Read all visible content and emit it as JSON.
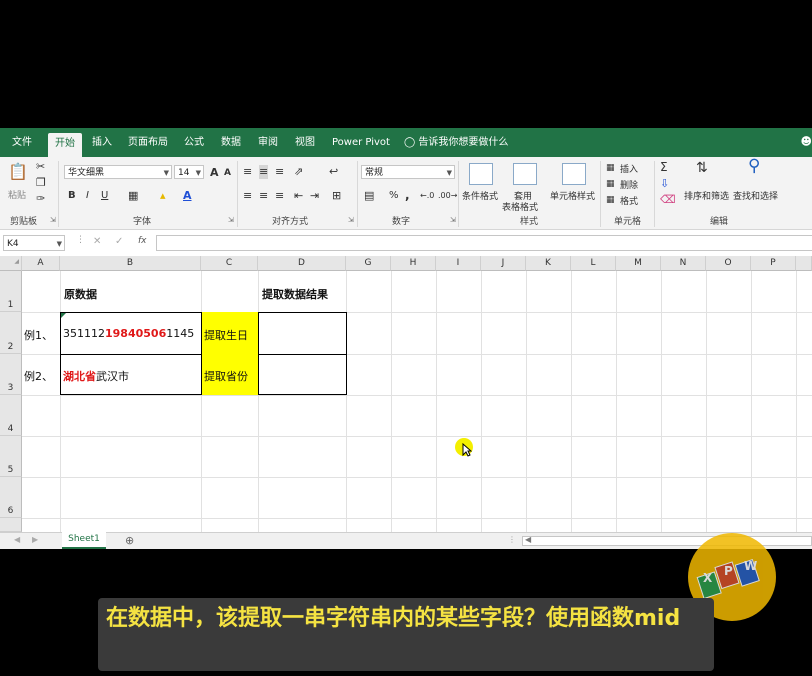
{
  "tabs": [
    "文件",
    "开始",
    "插入",
    "页面布局",
    "公式",
    "数据",
    "审阅",
    "视图",
    "Power Pivot"
  ],
  "active_tab": "开始",
  "tell_me": "告诉我你想要做什么",
  "ribbon": {
    "clipboard": {
      "paste": "粘贴",
      "label": "剪贴板"
    },
    "font": {
      "name": "华文细黑",
      "size": "14",
      "label": "字体",
      "bold": "B",
      "italic": "I",
      "underline": "U",
      "grow": "A",
      "shrink": "A"
    },
    "alignment": {
      "label": "对齐方式"
    },
    "number": {
      "format": "常规",
      "label": "数字",
      "percent": "%",
      "comma": ","
    },
    "styles": {
      "conditional": "条件格式",
      "table_format_1": "套用",
      "table_format_2": "表格格式",
      "cell_styles": "单元格样式",
      "label": "样式"
    },
    "cells": {
      "insert": "插入",
      "delete": "删除",
      "format": "格式",
      "label": "单元格"
    },
    "editing": {
      "sort_filter": "排序和筛选",
      "find_select": "查找和选择",
      "label": "编辑"
    }
  },
  "formula_bar": {
    "name_box": "K4",
    "fx": "fx",
    "value": ""
  },
  "columns": [
    "A",
    "B",
    "C",
    "D",
    "G",
    "H",
    "I",
    "J",
    "K",
    "L",
    "M",
    "N",
    "O",
    "P"
  ],
  "rows": [
    "1",
    "2",
    "3",
    "4",
    "5",
    "6"
  ],
  "cells": {
    "b1": "原数据",
    "d1": "提取数据结果",
    "a2": "例1、",
    "b2_part1": "351112",
    "b2_part2": "19840506",
    "b2_part3": "1145",
    "c2": "提取生日",
    "a3": "例2、",
    "b3_part1": "湖北省",
    "b3_part2": "武汉市",
    "c3": "提取省份"
  },
  "sheet_tab": "Sheet1",
  "logo_letters": [
    "X",
    "P",
    "W"
  ],
  "subtitle": "在数据中，该提取一串字符串内的某些字段？使用函数mid",
  "colors": {
    "excel_green": "#217346",
    "highlight_yellow": "#ffff00",
    "red_text": "#e01818",
    "subtitle_text": "#f5e342"
  }
}
